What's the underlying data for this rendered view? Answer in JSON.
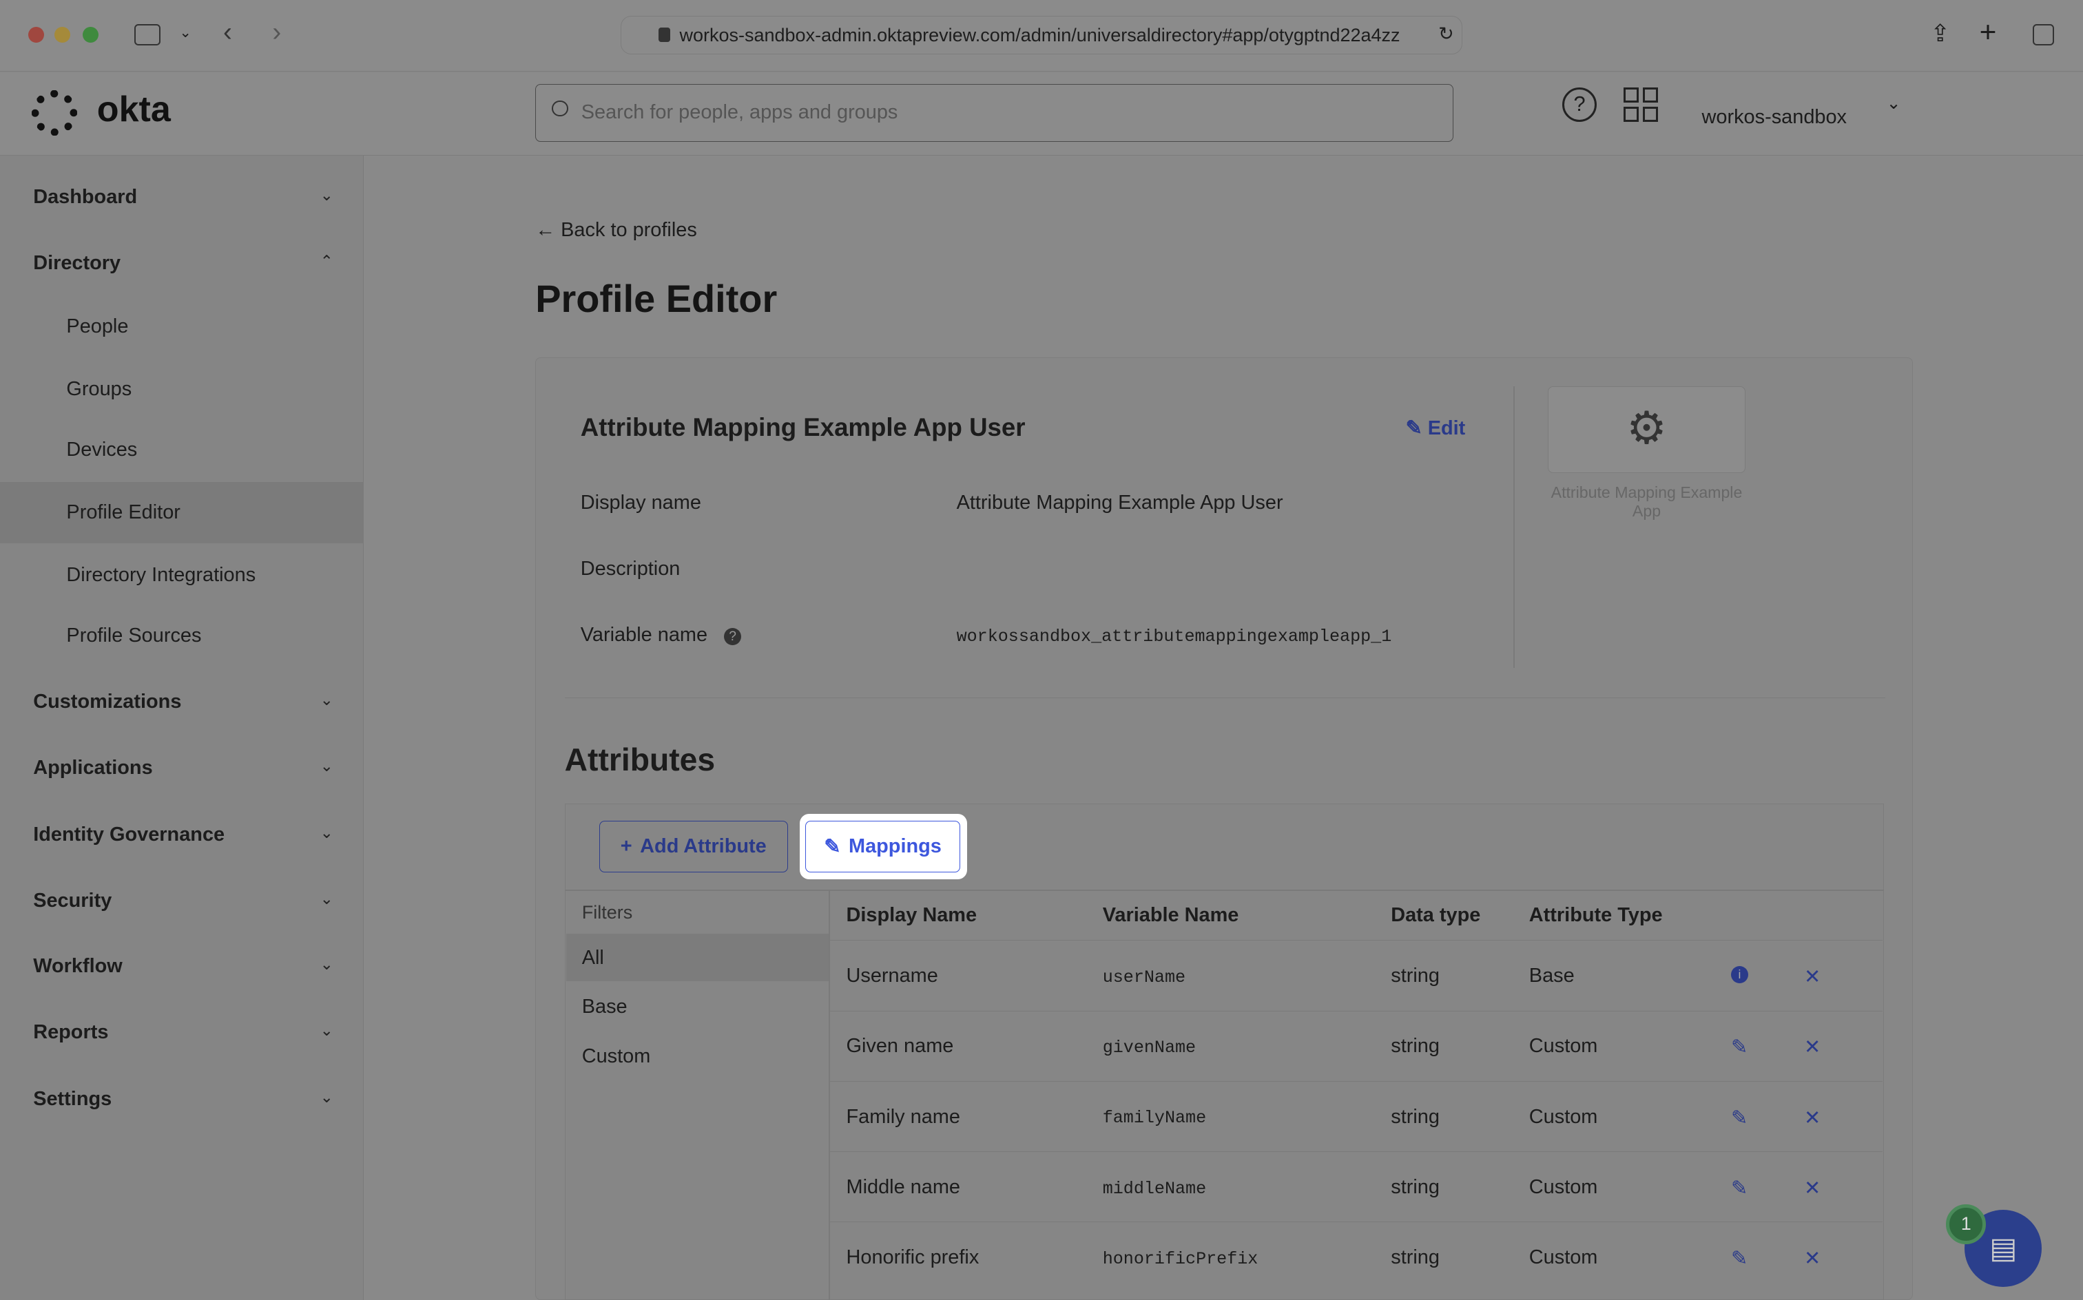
{
  "browser": {
    "url": "workos-sandbox-admin.oktapreview.com/admin/universaldirectory#app/otygptnd22a4zz"
  },
  "header": {
    "logo": "okta",
    "search_placeholder": "Search for people, apps and groups",
    "org": "workos-sandbox"
  },
  "sidebar": {
    "items": [
      {
        "label": "Dashboard",
        "expanded": false
      },
      {
        "label": "Directory",
        "expanded": true,
        "children": [
          "People",
          "Groups",
          "Devices",
          "Profile Editor",
          "Directory Integrations",
          "Profile Sources"
        ]
      },
      {
        "label": "Customizations",
        "expanded": false
      },
      {
        "label": "Applications",
        "expanded": false
      },
      {
        "label": "Identity Governance",
        "expanded": false
      },
      {
        "label": "Security",
        "expanded": false
      },
      {
        "label": "Workflow",
        "expanded": false
      },
      {
        "label": "Reports",
        "expanded": false
      },
      {
        "label": "Settings",
        "expanded": false
      }
    ],
    "active": "Profile Editor"
  },
  "main": {
    "back": "Back to profiles",
    "title": "Profile Editor",
    "profile": {
      "name": "Attribute Mapping Example App User",
      "edit": "Edit",
      "fields": [
        {
          "label": "Display name",
          "value": "Attribute Mapping Example App User"
        },
        {
          "label": "Description",
          "value": ""
        },
        {
          "label": "Variable name",
          "value": "workossandbox_attributemappingexampleapp_1"
        }
      ],
      "app_label": "Attribute Mapping Example App"
    },
    "attributes": {
      "title": "Attributes",
      "add": "Add Attribute",
      "mappings": "Mappings",
      "filters_title": "Filters",
      "filters": [
        "All",
        "Base",
        "Custom"
      ],
      "columns": [
        "Display Name",
        "Variable Name",
        "Data type",
        "Attribute Type"
      ],
      "rows": [
        [
          "Username",
          "userName",
          "string",
          "Base"
        ],
        [
          "Given name",
          "givenName",
          "string",
          "Custom"
        ],
        [
          "Family name",
          "familyName",
          "string",
          "Custom"
        ],
        [
          "Middle name",
          "middleName",
          "string",
          "Custom"
        ],
        [
          "Honorific prefix",
          "honorificPrefix",
          "string",
          "Custom"
        ]
      ]
    }
  },
  "chat": {
    "badge": "1"
  }
}
